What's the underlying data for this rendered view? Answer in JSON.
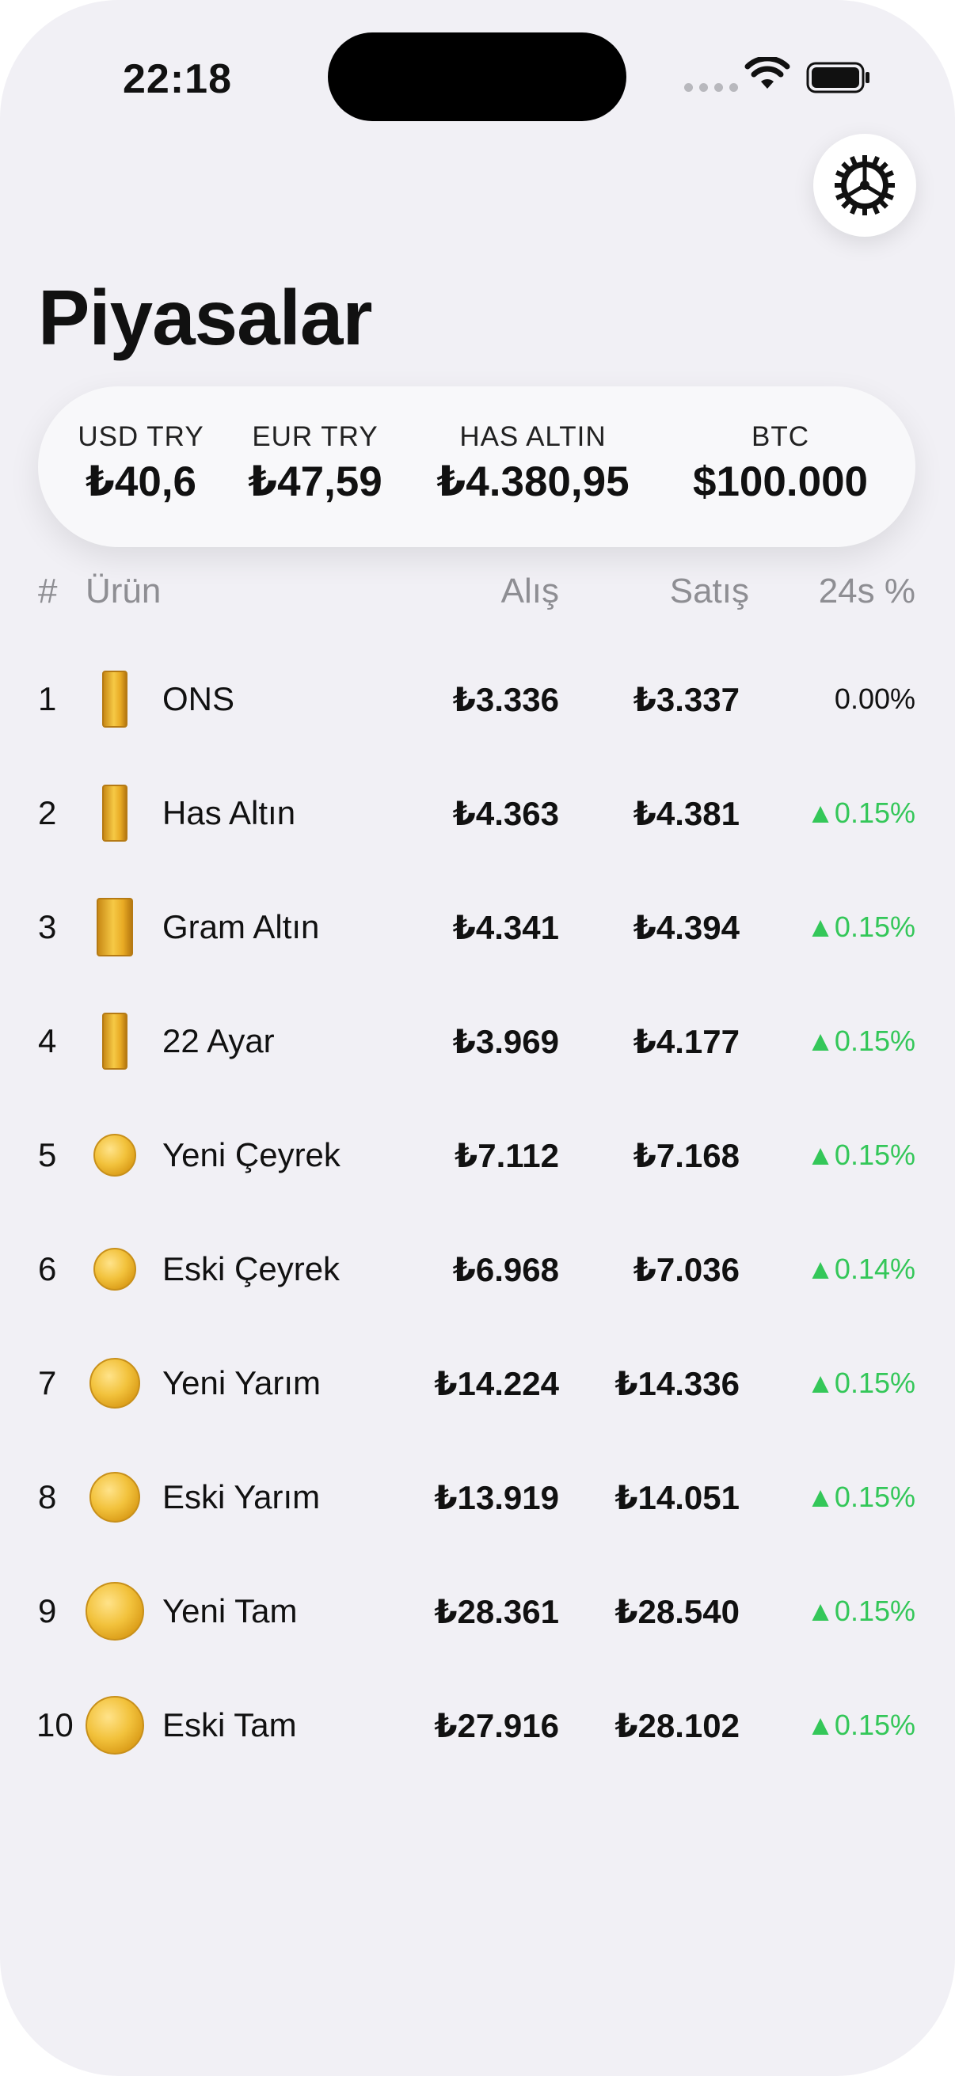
{
  "status_bar": {
    "time": "22:18"
  },
  "header": {
    "title": "Piyasalar",
    "settings_icon": "gear-icon"
  },
  "ticker": [
    {
      "label": "USD TRY",
      "value": "₺40,6"
    },
    {
      "label": "EUR TRY",
      "value": "₺47,59"
    },
    {
      "label": "HAS ALTIN",
      "value": "₺4.380,95"
    },
    {
      "label": "BTC",
      "value": "$100.000"
    }
  ],
  "table": {
    "columns": {
      "rank": "#",
      "product": "Ürün",
      "buy": "Alış",
      "sell": "Satış",
      "change": "24s %"
    },
    "rows": [
      {
        "rank": "1",
        "name": "ONS",
        "icon": "gold-bar-icon",
        "buy": "₺3.336",
        "sell": "₺3.337",
        "change": "0.00%",
        "trend": "flat"
      },
      {
        "rank": "2",
        "name": "Has Altın",
        "icon": "gold-bar-icon",
        "buy": "₺4.363",
        "sell": "₺4.381",
        "change": "0.15%",
        "trend": "up"
      },
      {
        "rank": "3",
        "name": "Gram Altın",
        "icon": "gram-gold-bar-icon",
        "buy": "₺4.341",
        "sell": "₺4.394",
        "change": "0.15%",
        "trend": "up"
      },
      {
        "rank": "4",
        "name": "22 Ayar",
        "icon": "gold-bar-icon",
        "buy": "₺3.969",
        "sell": "₺4.177",
        "change": "0.15%",
        "trend": "up"
      },
      {
        "rank": "5",
        "name": "Yeni Çeyrek",
        "icon": "gold-coin-icon",
        "buy": "₺7.112",
        "sell": "₺7.168",
        "change": "0.15%",
        "trend": "up"
      },
      {
        "rank": "6",
        "name": "Eski Çeyrek",
        "icon": "gold-coin-icon",
        "buy": "₺6.968",
        "sell": "₺7.036",
        "change": "0.14%",
        "trend": "up"
      },
      {
        "rank": "7",
        "name": "Yeni Yarım",
        "icon": "gold-coin-icon",
        "buy": "₺14.224",
        "sell": "₺14.336",
        "change": "0.15%",
        "trend": "up"
      },
      {
        "rank": "8",
        "name": "Eski Yarım",
        "icon": "gold-coin-icon",
        "buy": "₺13.919",
        "sell": "₺14.051",
        "change": "0.15%",
        "trend": "up"
      },
      {
        "rank": "9",
        "name": "Yeni Tam",
        "icon": "gold-coin-icon",
        "buy": "₺28.361",
        "sell": "₺28.540",
        "change": "0.15%",
        "trend": "up"
      },
      {
        "rank": "10",
        "name": "Eski Tam",
        "icon": "gold-coin-icon",
        "buy": "₺27.916",
        "sell": "₺28.102",
        "change": "0.15%",
        "trend": "up"
      }
    ]
  },
  "colors": {
    "up": "#34c759",
    "background": "#f1f0f5",
    "gold": "#f2c23c"
  }
}
